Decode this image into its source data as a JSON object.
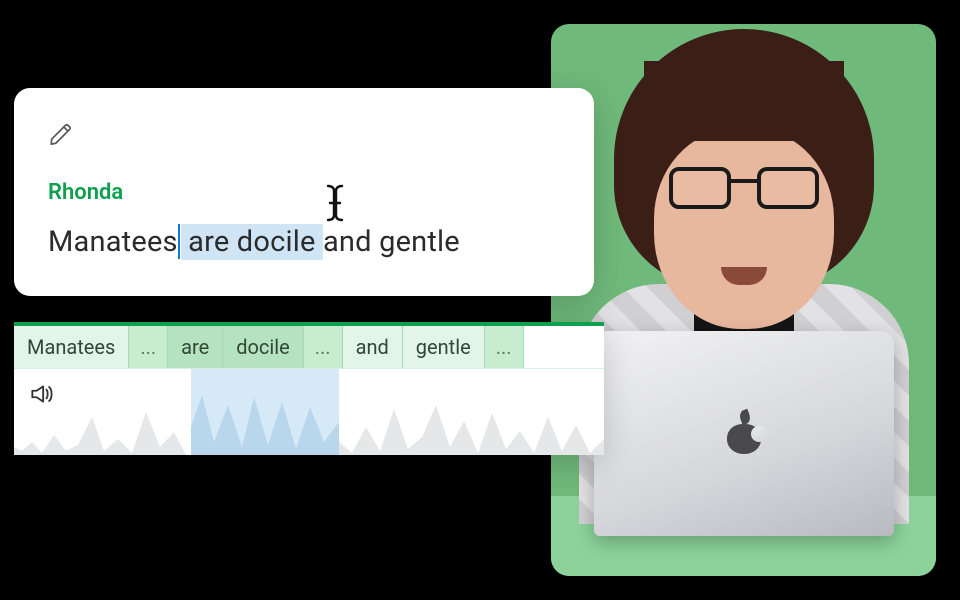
{
  "colors": {
    "accent_green": "#0e9f4f",
    "selection_blue": "#cfe5f6",
    "photo_bg": "#6fb97a"
  },
  "editor": {
    "speaker": "Rhonda",
    "transcript": {
      "pre": "Manatees",
      "selected": " are docile ",
      "post": "and gentle"
    }
  },
  "timeline": {
    "words": [
      {
        "text": "Manatees",
        "kind": "word"
      },
      {
        "text": "...",
        "kind": "gap"
      },
      {
        "text": "are",
        "kind": "word",
        "selected": true
      },
      {
        "text": "docile",
        "kind": "word",
        "selected": true
      },
      {
        "text": "...",
        "kind": "gap"
      },
      {
        "text": "and",
        "kind": "word"
      },
      {
        "text": "gentle",
        "kind": "word"
      },
      {
        "text": "...",
        "kind": "gap"
      }
    ]
  },
  "icons": {
    "pencil": "pencil-icon",
    "ibeam": "text-cursor-icon",
    "speaker": "speaker-icon",
    "apple": "apple-logo-icon"
  }
}
